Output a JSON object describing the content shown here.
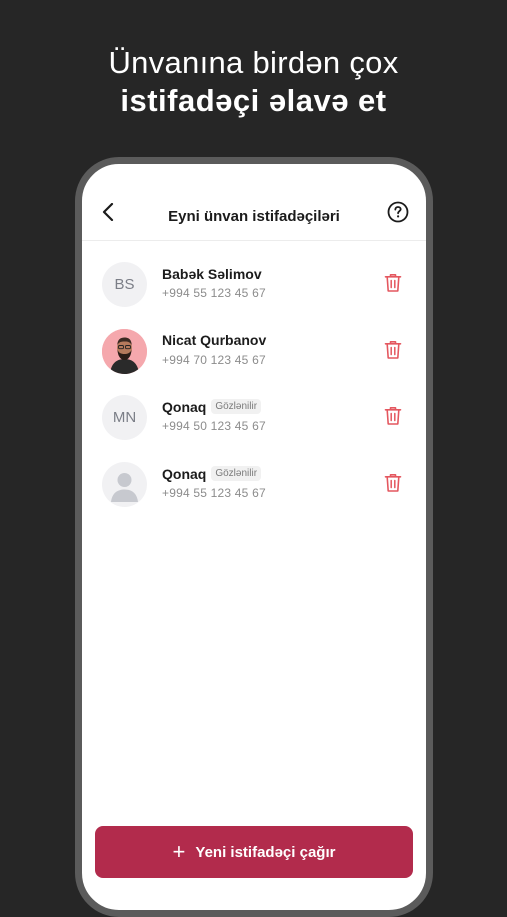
{
  "promo": {
    "line1": "Ünvanına birdən çox",
    "line2": "istifadəçi əlavə et"
  },
  "header": {
    "title": "Eyni ünvan istifadəçiləri",
    "back_icon": "chevron-left-icon",
    "help_icon": "question-circle-icon"
  },
  "users": [
    {
      "initials": "BS",
      "name": "Babək Səlimov",
      "badge": "",
      "phone": "+994 55 123 45 67",
      "avatar": "initials"
    },
    {
      "initials": "",
      "name": "Nicat Qurbanov",
      "badge": "",
      "phone": "+994 70 123 45 67",
      "avatar": "photo"
    },
    {
      "initials": "MN",
      "name": "Qonaq",
      "badge": "Gözlənilir",
      "phone": "+994 50 123 45 67",
      "avatar": "initials"
    },
    {
      "initials": "",
      "name": "Qonaq",
      "badge": "Gözlənilir",
      "phone": "+994 55 123 45 67",
      "avatar": "placeholder"
    }
  ],
  "actions": {
    "invite_label": "Yeni istifadəçi çağır",
    "invite_icon": "plus-icon",
    "delete_icon": "trash-icon"
  },
  "colors": {
    "accent": "#B22B4C",
    "delete": "#E4575F",
    "background": "#262626"
  }
}
